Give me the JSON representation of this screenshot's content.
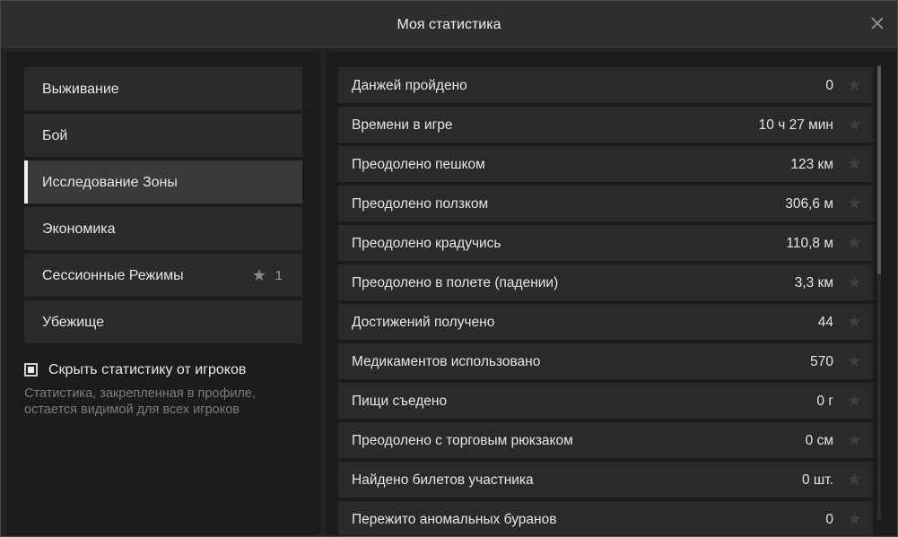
{
  "window": {
    "title": "Моя статистика",
    "close_icon": "close-icon"
  },
  "categories": [
    {
      "label": "Выживание",
      "active": false
    },
    {
      "label": "Бой",
      "active": false
    },
    {
      "label": "Исследование Зоны",
      "active": true
    },
    {
      "label": "Экономика",
      "active": false
    },
    {
      "label": "Сессионные Режимы",
      "active": false,
      "pinned_count": "1",
      "icon": "star-icon"
    },
    {
      "label": "Убежище",
      "active": false
    }
  ],
  "privacy": {
    "checkbox_label": "Скрыть статистику от игроков",
    "checked": true,
    "hint": "Статистика, закрепленная в профиле, остается видимой для всех игроков"
  },
  "stats": [
    {
      "name": "Данжей пройдено",
      "value": "0"
    },
    {
      "name": "Времени в игре",
      "value": "10 ч 27 мин"
    },
    {
      "name": "Преодолено пешком",
      "value": "123 км"
    },
    {
      "name": "Преодолено ползком",
      "value": "306,6 м"
    },
    {
      "name": "Преодолено крадучись",
      "value": "110,8 м"
    },
    {
      "name": "Преодолено в полете (падении)",
      "value": "3,3 км"
    },
    {
      "name": "Достижений получено",
      "value": "44"
    },
    {
      "name": "Медикаментов использовано",
      "value": "570"
    },
    {
      "name": "Пищи съедено",
      "value": "0 г"
    },
    {
      "name": "Преодолено с торговым рюкзаком",
      "value": "0 см"
    },
    {
      "name": "Найдено билетов участника",
      "value": "0 шт."
    },
    {
      "name": "Пережито аномальных буранов",
      "value": "0"
    }
  ],
  "colors": {
    "accent": "#f2f2f2",
    "background": "#1c1c1c",
    "row": "#2a2a2a",
    "pin_inactive": "#3f3f3f"
  }
}
